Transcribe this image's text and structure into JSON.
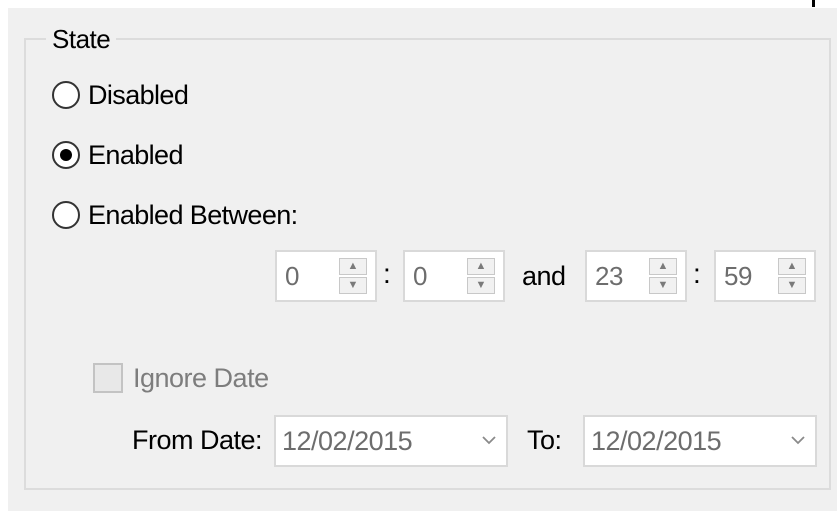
{
  "state_group": {
    "legend": "State",
    "options": [
      {
        "label": "Disabled",
        "checked": false
      },
      {
        "label": "Enabled",
        "checked": true
      },
      {
        "label": "Enabled Between:",
        "checked": false
      }
    ]
  },
  "time_range": {
    "start_hour": "0",
    "start_minute": "0",
    "separator": ":",
    "and_label": "and",
    "end_hour": "23",
    "end_minute": "59"
  },
  "ignore_date": {
    "label": "Ignore Date",
    "checked": false,
    "enabled": false
  },
  "dates": {
    "from_label": "From Date:",
    "from_value": "12/02/2015",
    "to_label": "To:",
    "to_value": "12/02/2015"
  },
  "icons": {
    "spin_up": "chevron-up-icon",
    "spin_down": "chevron-down-icon",
    "dropdown": "chevron-down-icon"
  },
  "colors": {
    "panel_background": "#f0f0f0",
    "disabled_text": "#7d7d7d",
    "input_text": "#6d6d6d"
  }
}
